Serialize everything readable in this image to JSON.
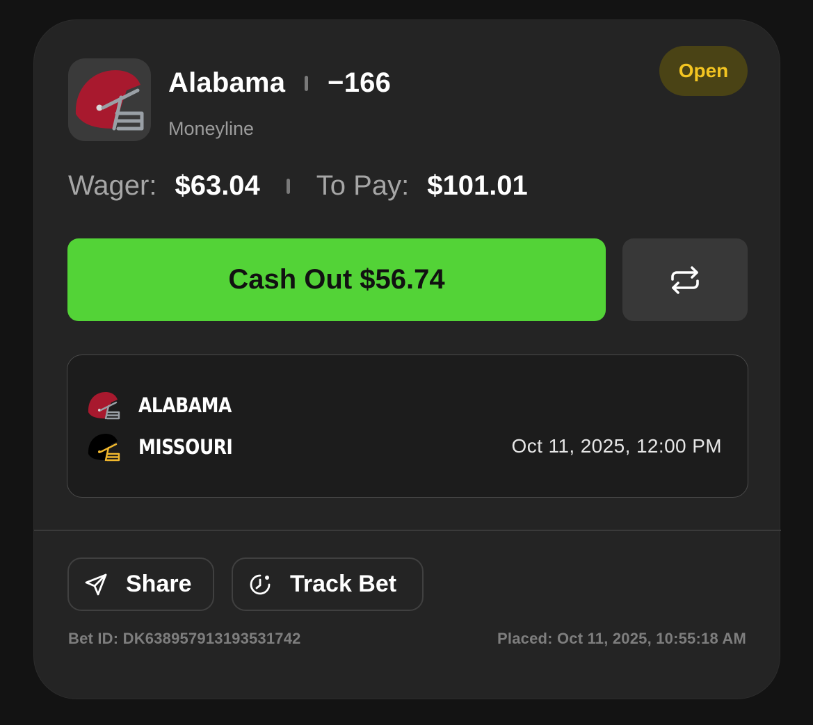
{
  "bet": {
    "team": "Alabama",
    "odds": "−166",
    "type": "Moneyline",
    "status": "Open",
    "wager_label": "Wager:",
    "wager_value": "$63.04",
    "topay_label": "To Pay:",
    "topay_value": "$101.01",
    "cashout_label": "Cash Out $56.74",
    "bet_id": "Bet ID: DK638957913193531742",
    "placed": "Placed: Oct 11, 2025, 10:55:18 AM"
  },
  "game": {
    "teams": [
      {
        "name": "ALABAMA",
        "icon": "alabama-helmet-icon"
      },
      {
        "name": "MISSOURI",
        "icon": "missouri-helmet-icon"
      }
    ],
    "datetime": "Oct 11, 2025, 12:00 PM"
  },
  "actions": {
    "share_label": "Share",
    "track_label": "Track Bet"
  },
  "colors": {
    "accent_green": "#53d337",
    "status_yellow": "#f3c521",
    "alabama_crimson": "#a8192e",
    "missouri_gold": "#f1b82d"
  }
}
